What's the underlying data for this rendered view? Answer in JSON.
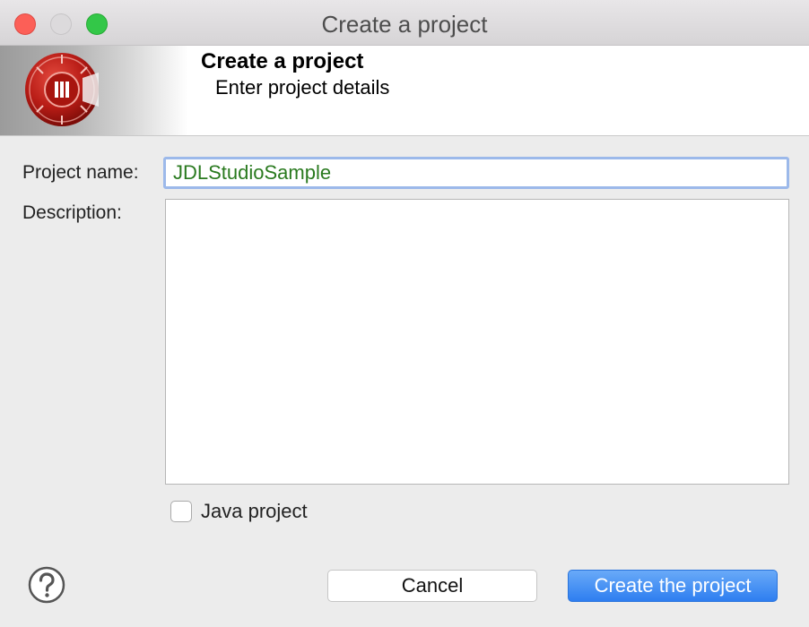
{
  "window": {
    "title": "Create a project"
  },
  "banner": {
    "title": "Create a project",
    "subtitle": "Enter project details"
  },
  "form": {
    "project_name_label": "Project name:",
    "project_name_value": "JDLStudioSample",
    "description_label": "Description:",
    "description_value": "",
    "java_project_label": "Java project",
    "java_project_checked": false
  },
  "buttons": {
    "cancel": "Cancel",
    "create": "Create the project"
  },
  "icons": {
    "help": "help-icon",
    "logo": "app-logo-icon"
  },
  "colors": {
    "primary_button": "#2e7ef0",
    "input_text": "#2a7a1f",
    "focus_ring": "#9cb9ea"
  }
}
